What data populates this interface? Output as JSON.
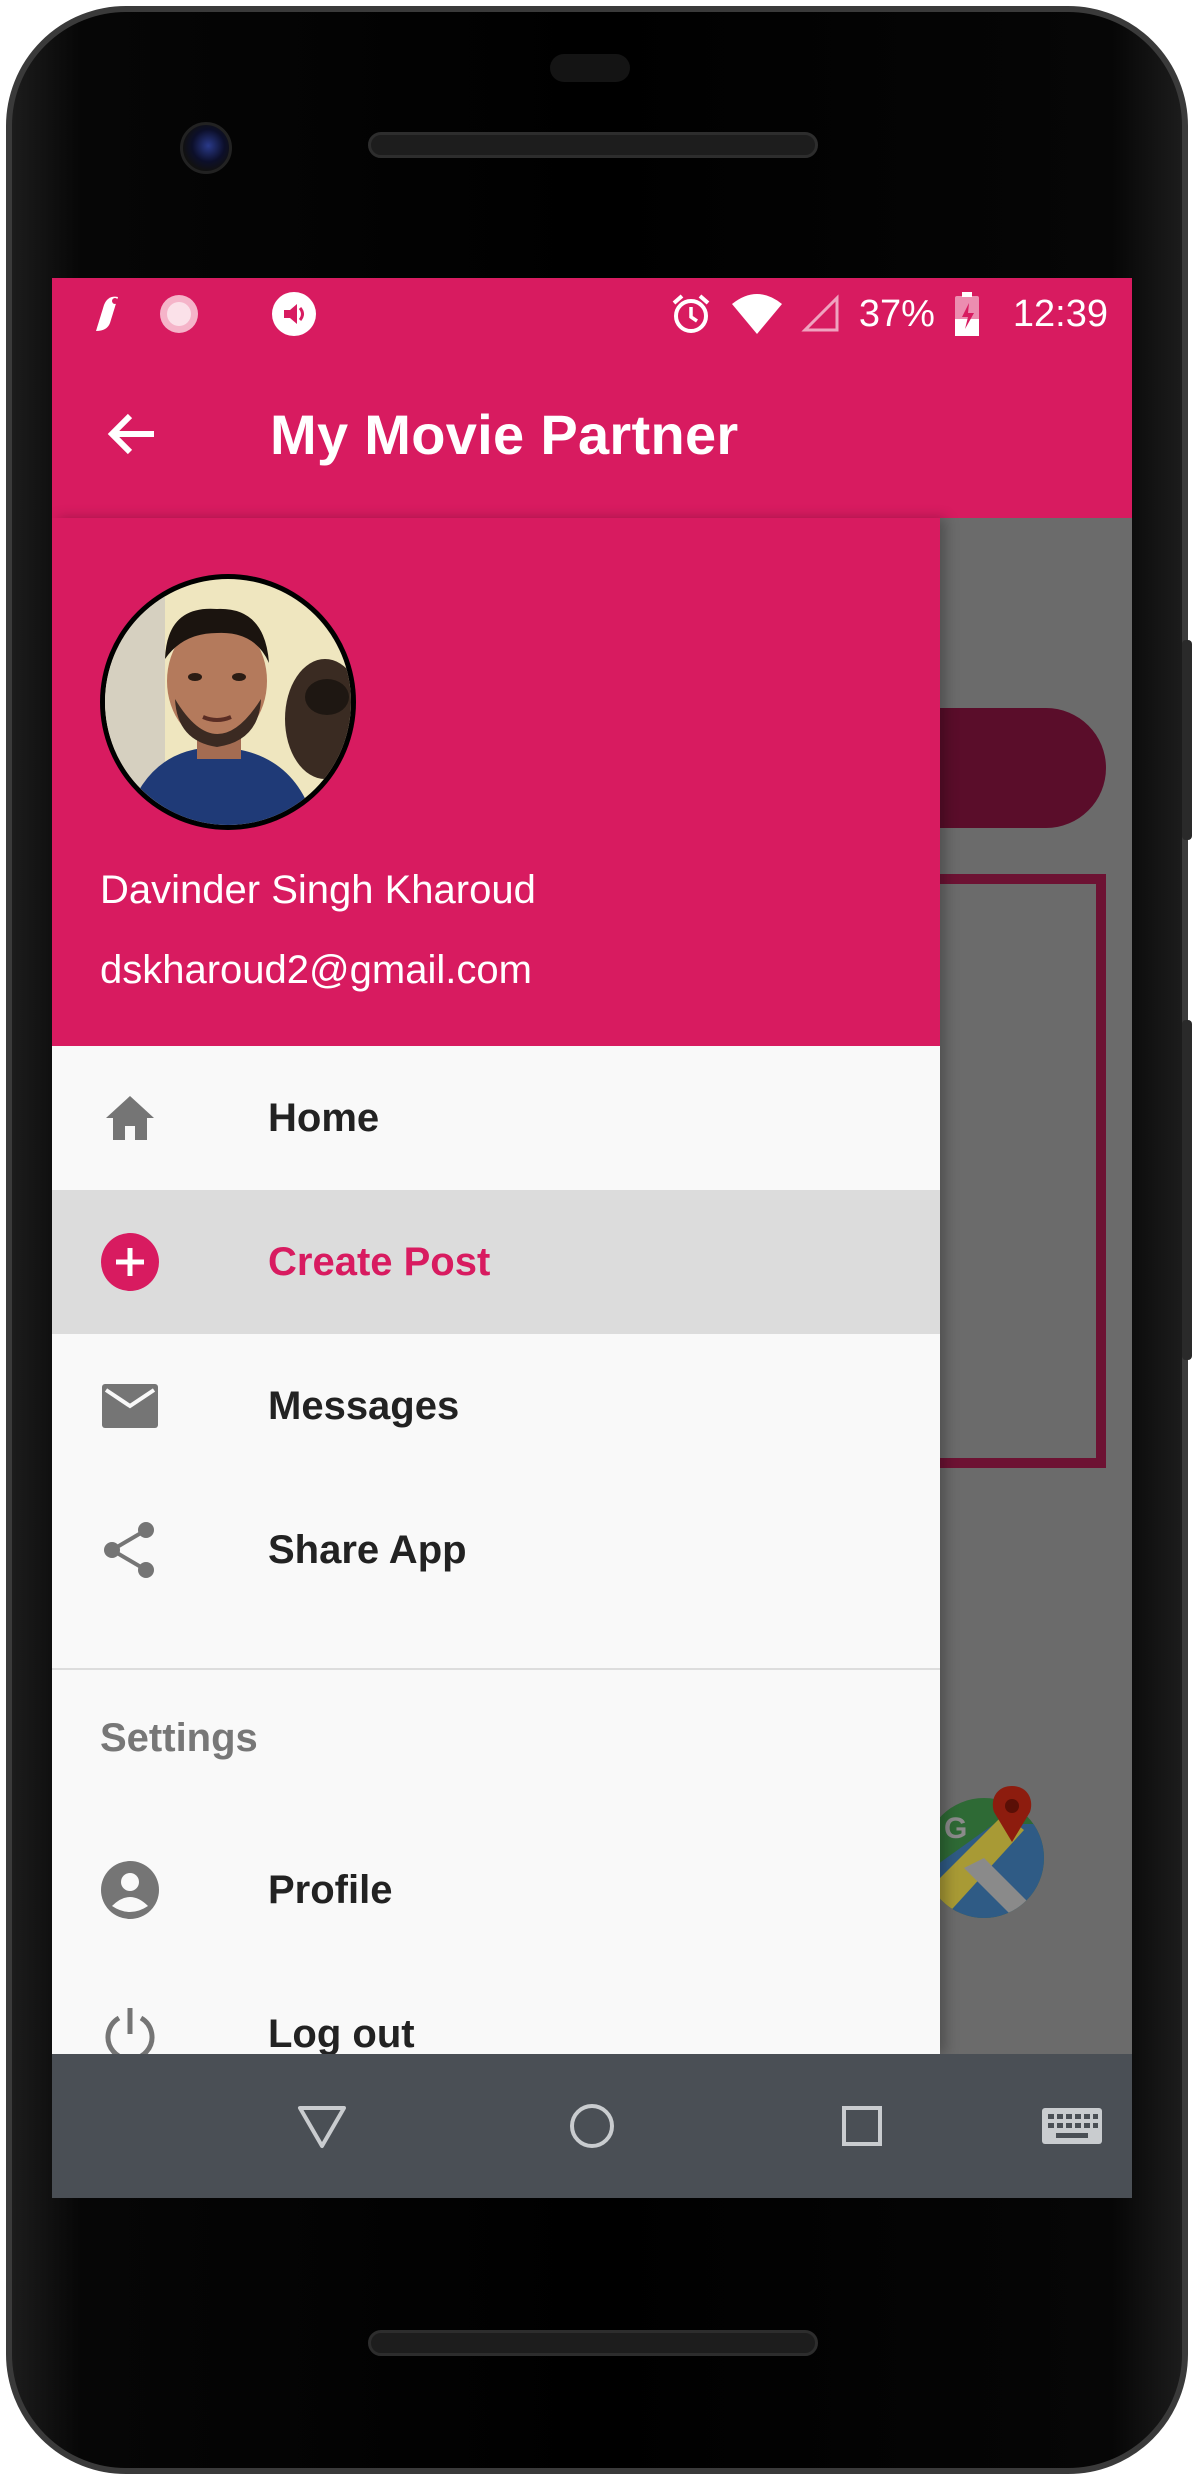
{
  "status_bar": {
    "battery": "37%",
    "time": "12:39"
  },
  "app_bar": {
    "title": "My Movie Partner"
  },
  "drawer": {
    "user_name": "Davinder Singh Kharoud",
    "user_email": "dskharoud2@gmail.com",
    "items": [
      {
        "label": "Home",
        "icon": "home-icon"
      },
      {
        "label": "Create Post",
        "icon": "add-circle-icon",
        "active": true
      },
      {
        "label": "Messages",
        "icon": "mail-icon"
      },
      {
        "label": "Share App",
        "icon": "share-icon"
      }
    ],
    "settings_header": "Settings",
    "settings_items": [
      {
        "label": "Profile",
        "icon": "account-circle-icon"
      },
      {
        "label": "Log out",
        "icon": "power-icon"
      }
    ]
  },
  "colors": {
    "primary": "#d81b60",
    "menu_icon": "#757575",
    "active_bg": "#dcdcdc",
    "nav_bar": "#4a4f55"
  }
}
